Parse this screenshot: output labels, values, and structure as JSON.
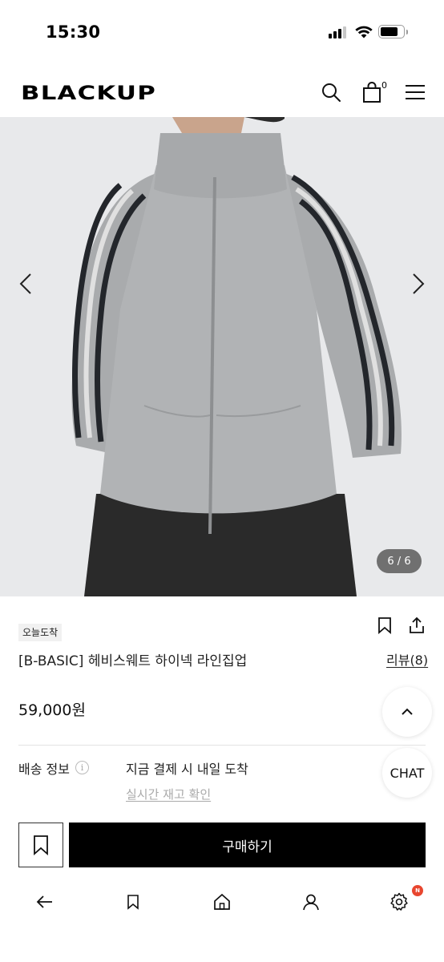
{
  "status_bar": {
    "time": "15:30"
  },
  "header": {
    "logo": "BLACKUP",
    "cart_count": "0"
  },
  "carousel": {
    "pager": "6 / 6"
  },
  "product": {
    "badge": "오늘도착",
    "title": "[B-BASIC] 헤비스웨트 하이넥 라인집업",
    "reviews": "리뷰(8)",
    "price": "59,000원"
  },
  "shipping": {
    "label": "배송 정보",
    "info_icon": "i",
    "value": "지금 결제 시 내일 도착",
    "stock_link": "실시간 재고 확인"
  },
  "floating": {
    "chat": "CHAT"
  },
  "actions": {
    "buy": "구매하기"
  },
  "bottom_nav": {
    "settings_badge": "N"
  },
  "icons": [
    "search-icon",
    "cart-icon",
    "menu-icon",
    "chevron-left-icon",
    "chevron-right-icon",
    "bookmark-icon",
    "share-icon",
    "chevron-up-icon",
    "back-arrow-icon",
    "home-icon",
    "user-icon",
    "gear-icon"
  ],
  "colors": {
    "accent": "#000000",
    "background": "#ffffff",
    "badge_bg": "#f1f1f1",
    "notification": "#e8462f"
  }
}
